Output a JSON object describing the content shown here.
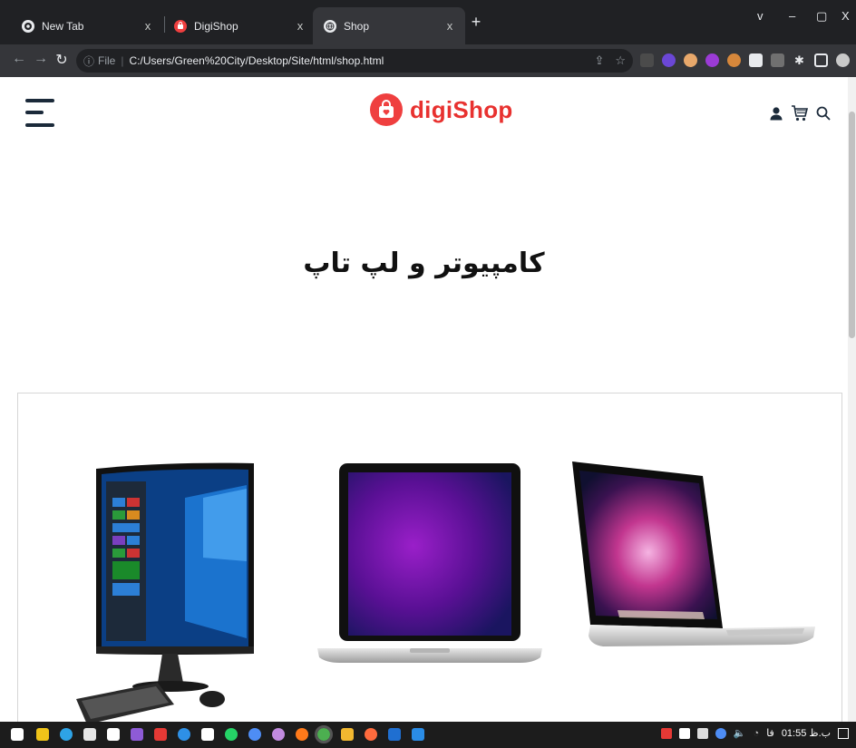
{
  "browser": {
    "tabs": [
      {
        "title": "New Tab",
        "icon": "chrome-icon",
        "active": false
      },
      {
        "title": "DigiShop",
        "icon": "digishop-favicon",
        "active": false
      },
      {
        "title": "Shop",
        "icon": "globe-icon",
        "active": true
      }
    ],
    "new_tab_label": "+",
    "close_glyph": "x",
    "window_controls": {
      "chevron": "v",
      "minimize": "–",
      "restore": "▢",
      "close": "X"
    },
    "address": {
      "scheme": "File",
      "url": "C:/Users/Green%20City/Desktop/Site/html/shop.html"
    }
  },
  "site": {
    "logo_text": "digiShop",
    "brand_color": "#ef3f3f",
    "header_icons": [
      "user-icon",
      "cart-icon",
      "search-icon"
    ],
    "section_title": "کامپیوتر و لپ تاپ",
    "products": [
      {
        "name": "desktop-computer",
        "icon": "desktop-pc-image"
      },
      {
        "name": "laptop-purple",
        "icon": "laptop-image"
      },
      {
        "name": "macbook",
        "icon": "macbook-image"
      }
    ]
  },
  "taskbar": {
    "clock": "01:55 ب.ظ",
    "lang": "فا"
  }
}
